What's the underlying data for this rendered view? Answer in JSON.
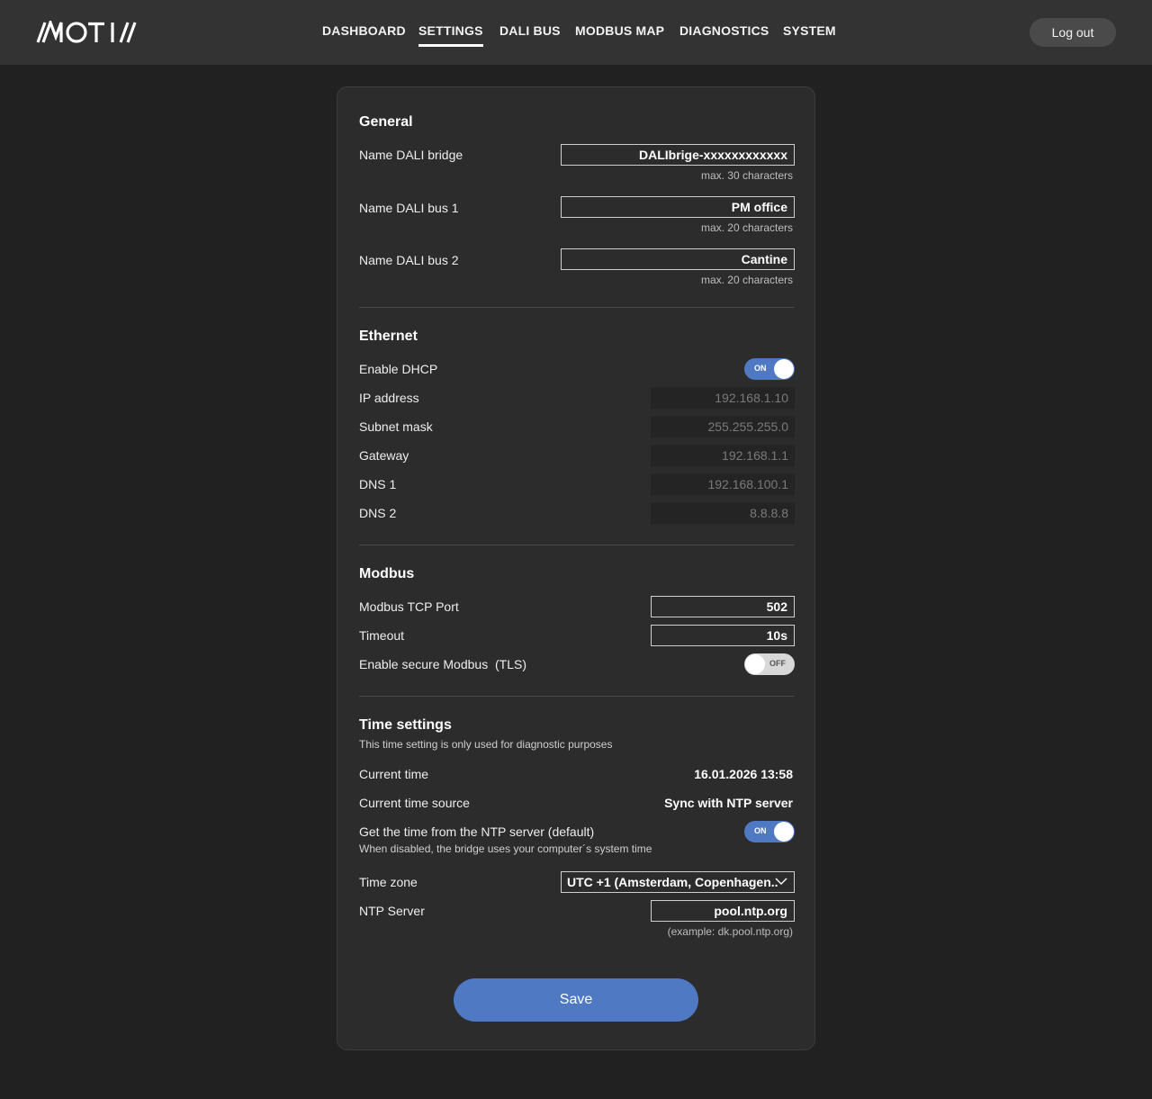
{
  "header": {
    "brand": "MOTIV",
    "nav": [
      "DASHBOARD",
      "SETTINGS",
      "DALI BUS",
      "MODBUS MAP",
      "DIAGNOSTICS",
      "SYSTEM"
    ],
    "active_nav": "SETTINGS",
    "logout_label": "Log out"
  },
  "general": {
    "title": "General",
    "bridge_name": {
      "label": "Name DALI bridge",
      "value": "DALIbrige-xxxxxxxxxxxx",
      "hint": "max. 30 characters"
    },
    "bus1_name": {
      "label": "Name DALI bus 1",
      "value": "PM office",
      "hint": "max. 20 characters"
    },
    "bus2_name": {
      "label": "Name DALI bus 2",
      "value": "Cantine",
      "hint": "max. 20 characters"
    }
  },
  "ethernet": {
    "title": "Ethernet",
    "dhcp": {
      "label": "Enable DHCP",
      "state": "ON"
    },
    "ip": {
      "label": "IP address",
      "value": "192.168.1.10"
    },
    "subnet": {
      "label": "Subnet mask",
      "value": "255.255.255.0"
    },
    "gateway": {
      "label": "Gateway",
      "value": "192.168.1.1"
    },
    "dns1": {
      "label": "DNS 1",
      "value": "192.168.100.1"
    },
    "dns2": {
      "label": "DNS 2",
      "value": "8.8.8.8"
    }
  },
  "modbus": {
    "title": "Modbus",
    "port": {
      "label": "Modbus TCP Port",
      "value": "502"
    },
    "timeout": {
      "label": "Timeout",
      "value": "10s"
    },
    "tls": {
      "label": "Enable secure Modbus  (TLS)",
      "state": "OFF"
    }
  },
  "time": {
    "title": "Time settings",
    "subtitle": "This time setting is only used for diagnostic purposes",
    "current": {
      "label": "Current time",
      "value": "16.01.2026 13:58"
    },
    "source": {
      "label": "Current time source",
      "value": "Sync with NTP server"
    },
    "ntp_toggle": {
      "label": "Get the time from the NTP server (default)",
      "hint": "When disabled, the bridge uses your computer´s system time",
      "state": "ON"
    },
    "timezone": {
      "label": "Time zone",
      "value": "UTC +1 (Amsterdam, Copenhagen.."
    },
    "ntp_server": {
      "label": "NTP Server",
      "value": "pool.ntp.org",
      "hint": "(example: dk.pool.ntp.org)"
    }
  },
  "save_label": "Save",
  "colors": {
    "accent": "#4f79c2",
    "background": "#212121",
    "card": "#2c2c2c",
    "topbar": "#333333"
  }
}
